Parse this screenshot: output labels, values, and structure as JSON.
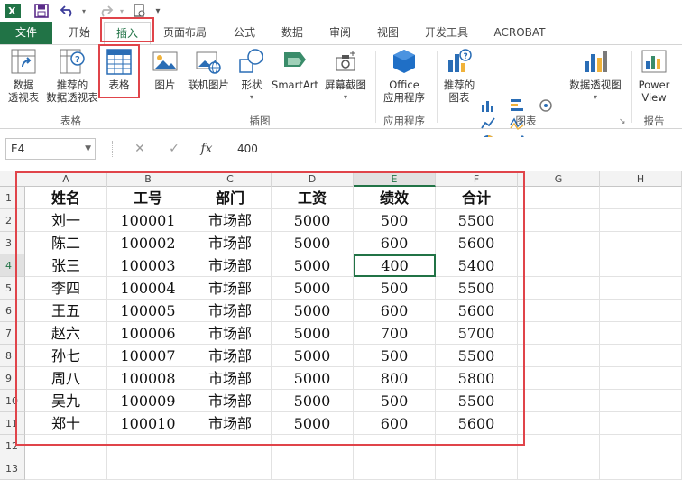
{
  "quick_access": {
    "app_icon": "excel-app-icon",
    "items": [
      "save-icon",
      "undo-icon",
      "redo-icon",
      "touch-mode-icon",
      "customize-dropdown-icon"
    ]
  },
  "tabs": [
    {
      "label": "文件"
    },
    {
      "label": "开始"
    },
    {
      "label": "插入"
    },
    {
      "label": "页面布局"
    },
    {
      "label": "公式"
    },
    {
      "label": "数据"
    },
    {
      "label": "审阅"
    },
    {
      "label": "视图"
    },
    {
      "label": "开发工具"
    },
    {
      "label": "ACROBAT"
    }
  ],
  "ribbon": {
    "tables": {
      "pivot_line1": "数据",
      "pivot_line2": "透视表",
      "rec_pivot_line1": "推荐的",
      "rec_pivot_line2": "数据透视表",
      "table": "表格",
      "group": "表格"
    },
    "illustrations": {
      "pictures": "图片",
      "online_pictures": "联机图片",
      "shapes": "形状",
      "smartart": "SmartArt",
      "screenshot": "屏幕截图",
      "group": "插图"
    },
    "apps": {
      "office_line1": "Office",
      "office_line2": "应用程序",
      "group": "应用程序"
    },
    "charts": {
      "rec_line1": "推荐的",
      "rec_line2": "图表",
      "pivot_chart": "数据透视图",
      "group": "图表"
    },
    "reports": {
      "power_line1": "Power",
      "power_line2": "View",
      "group": "报告"
    }
  },
  "formula_bar": {
    "name_box": "E4",
    "cancel": "✕",
    "enter": "✓",
    "fx": "fx",
    "value": "400"
  },
  "sheet": {
    "columns": [
      "A",
      "B",
      "C",
      "D",
      "E",
      "F",
      "G",
      "H"
    ],
    "rows": [
      "1",
      "2",
      "3",
      "4",
      "5",
      "6",
      "7",
      "8",
      "9",
      "10",
      "11",
      "12",
      "13"
    ],
    "headers": [
      "姓名",
      "工号",
      "部门",
      "工资",
      "绩效",
      "合计"
    ],
    "data": [
      [
        "刘一",
        "100001",
        "市场部",
        "5000",
        "500",
        "5500"
      ],
      [
        "陈二",
        "100002",
        "市场部",
        "5000",
        "600",
        "5600"
      ],
      [
        "张三",
        "100003",
        "市场部",
        "5000",
        "400",
        "5400"
      ],
      [
        "李四",
        "100004",
        "市场部",
        "5000",
        "500",
        "5500"
      ],
      [
        "王五",
        "100005",
        "市场部",
        "5000",
        "600",
        "5600"
      ],
      [
        "赵六",
        "100006",
        "市场部",
        "5000",
        "700",
        "5700"
      ],
      [
        "孙七",
        "100007",
        "市场部",
        "5000",
        "500",
        "5500"
      ],
      [
        "周八",
        "100008",
        "市场部",
        "5000",
        "800",
        "5800"
      ],
      [
        "吴九",
        "100009",
        "市场部",
        "5000",
        "500",
        "5500"
      ],
      [
        "郑十",
        "100010",
        "市场部",
        "5000",
        "600",
        "5600"
      ]
    ],
    "selected_cell": "E4"
  },
  "colors": {
    "excel_green": "#217346",
    "highlight_red": "#e0444a"
  }
}
